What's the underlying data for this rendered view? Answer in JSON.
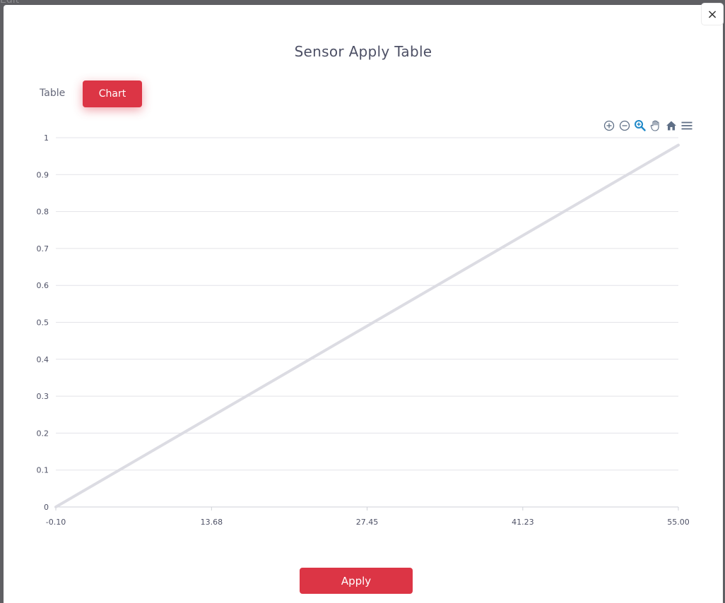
{
  "backdrop": {
    "text": "Edit"
  },
  "dialog": {
    "title": "Sensor Apply Table",
    "close_symbol": "×",
    "tabs": [
      {
        "label": "Table",
        "active": false
      },
      {
        "label": "Chart",
        "active": true
      }
    ],
    "apply_label": "Apply"
  },
  "toolbar": {
    "icons": [
      "zoom-in-icon",
      "zoom-out-icon",
      "zoom-selection-icon",
      "pan-hand-icon",
      "reset-home-icon",
      "menu-icon"
    ]
  },
  "colors": {
    "accent": "#dc3545",
    "line": "#dcdce3",
    "grid": "#e3e3e8",
    "text": "#4d5065"
  },
  "chart_data": {
    "type": "line",
    "title": "",
    "xlabel": "",
    "ylabel": "",
    "x_ticks": [
      "-0.10",
      "13.68",
      "27.45",
      "41.23",
      "55.00"
    ],
    "y_ticks": [
      "0",
      "0.1",
      "0.2",
      "0.3",
      "0.4",
      "0.5",
      "0.6",
      "0.7",
      "0.8",
      "0.9",
      "1"
    ],
    "xlim": [
      -0.1,
      55.0
    ],
    "ylim": [
      0,
      1
    ],
    "grid": true,
    "series": [
      {
        "x": [
          -0.1,
          55.0
        ],
        "y": [
          0,
          0.98
        ]
      }
    ]
  }
}
